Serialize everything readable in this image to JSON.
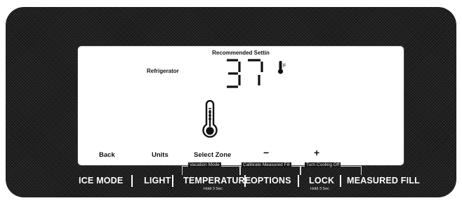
{
  "display": {
    "recommended_label": "Recommended Settin",
    "zone_label": "Refrigerator",
    "temperature_value": "37",
    "temperature_unit": "F",
    "soft_keys": {
      "back": "Back",
      "units": "Units",
      "select_zone": "Select Zone",
      "minus": "−",
      "plus": "+"
    }
  },
  "hold_functions": {
    "vacation_mode": "Vacation Mode",
    "calibrate_measured_fill": "Calibrate Measured Fill",
    "turn_cooling_off": "Turn Cooling Off"
  },
  "buttons": {
    "ice_mode": "ICE MODE",
    "light": "LIGHT",
    "temperature": "TEMPERATURE",
    "temperature_hint": "Hold 3 Sec",
    "options": "OPTIONS",
    "lock": "LOCK",
    "lock_hint": "Hold 3 Sec",
    "measured_fill": "MEASURED FILL"
  },
  "icons": {
    "unit_icon": "thermometer-icon",
    "zone_icon": "thermometer-icon"
  },
  "colors": {
    "panel": "#161616",
    "screen": "#ffffff",
    "label_text": "#ffffff"
  }
}
